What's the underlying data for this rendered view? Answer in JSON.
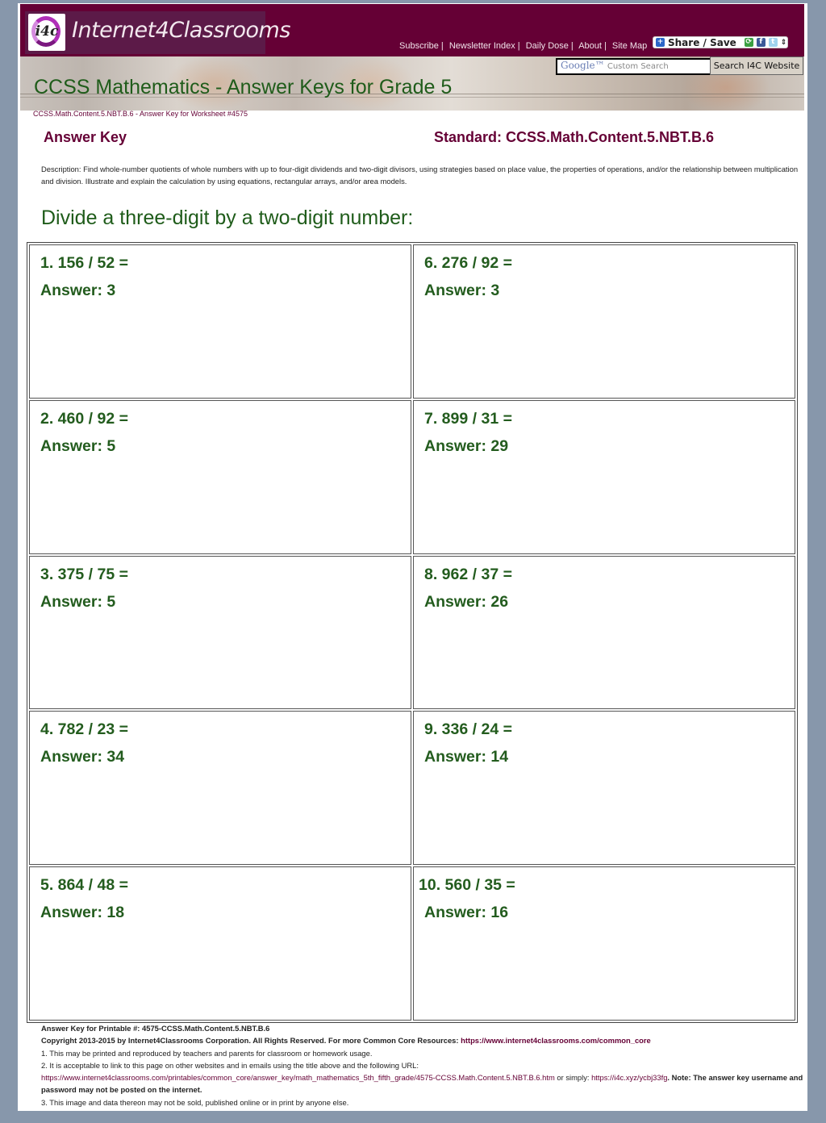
{
  "header": {
    "logo_icon_text": "i4c",
    "logo_text": "Internet4Classrooms",
    "nav": [
      {
        "label": "Subscribe"
      },
      {
        "label": "Newsletter Index"
      },
      {
        "label": "Daily Dose"
      },
      {
        "label": "About"
      },
      {
        "label": "Site Map"
      }
    ],
    "nav_separator": "|",
    "share_label": "Share / Save",
    "share_icons": [
      "plus-icon",
      "email-icon",
      "facebook-icon",
      "twitter-icon",
      "more-icon"
    ],
    "search_placeholder_brand": "Google™",
    "search_placeholder": "Custom Search",
    "search_button": "Search I4C Website"
  },
  "banner": {
    "title": "CCSS Mathematics - Answer Keys for Grade 5"
  },
  "breadcrumb": "CCSS.Math.Content.5.NBT.B.6 - Answer Key for Worksheet #4575",
  "answer_key_heading": "Answer Key",
  "standard_heading": "Standard: CCSS.Math.Content.5.NBT.B.6",
  "description": "Description: Find whole-number quotients of whole numbers with up to four-digit dividends and two-digit divisors, using strategies based on place value, the properties of operations, and/or the relationship between multiplication and division. Illustrate and explain the calculation by using equations, rectangular arrays, and/or area models.",
  "section_heading": "Divide a three-digit by a two-digit number:",
  "problems": [
    {
      "question": "1. 156 / 52 =",
      "answer": "Answer: 3"
    },
    {
      "question": "6. 276 / 92 =",
      "answer": "Answer: 3"
    },
    {
      "question": "2. 460 / 92 =",
      "answer": "Answer: 5"
    },
    {
      "question": "7. 899 / 31 =",
      "answer": "Answer: 29"
    },
    {
      "question": "3. 375 / 75 =",
      "answer": "Answer: 5"
    },
    {
      "question": "8. 962 / 37 =",
      "answer": "Answer: 26"
    },
    {
      "question": "4. 782 / 23 =",
      "answer": "Answer: 34"
    },
    {
      "question": "9. 336 / 24 =",
      "answer": "Answer: 14"
    },
    {
      "question": "5. 864 / 48 =",
      "answer": "Answer: 18"
    },
    {
      "question": "10. 560 / 35 =",
      "answer": "Answer: 16"
    }
  ],
  "footer": {
    "printable": "Answer Key for Printable #: 4575-CCSS.Math.Content.5.NBT.B.6",
    "copyright": "Copyright 2013-2015 by Internet4Classrooms Corporation. All Rights Reserved. For more Common Core Resources:",
    "copyright_link": "https://www.internet4classrooms.com/common_core",
    "line1": "1. This may be printed and reproduced by teachers and parents for classroom or homework usage.",
    "line2": "2. It is acceptable to link to this page on other websites and in emails using the title above and the following URL:",
    "url_long": "https://www.internet4classrooms.com/printables/common_core/answer_key/math_mathematics_5th_fifth_grade/4575-CCSS.Math.Content.5.NBT.B.6.htm",
    "or_simply": "or simply:",
    "url_short": "https://i4c.xyz/ycbj33fg",
    "note": ". Note: The answer key username and password may not be posted on the internet.",
    "line3": "3. This image and data thereon may not be sold, published online or in print by anyone else."
  },
  "colors": {
    "brand_maroon": "#650035",
    "heading_green": "#1f5c1a",
    "page_background": "#8797ab"
  }
}
